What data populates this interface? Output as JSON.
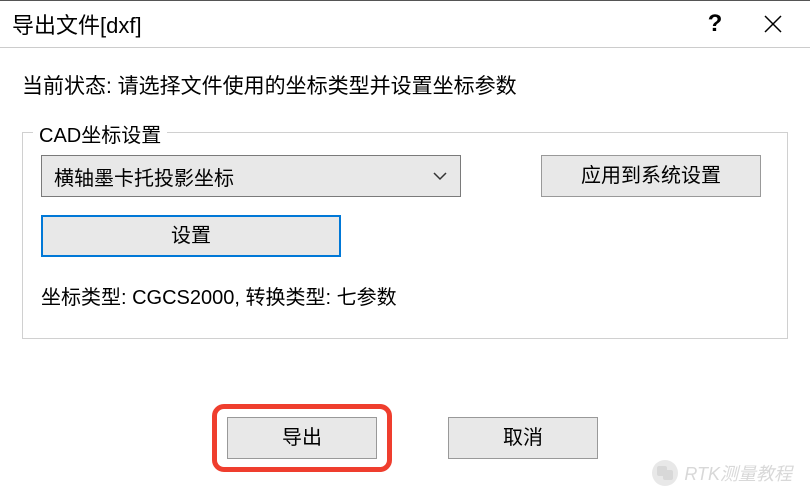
{
  "titlebar": {
    "title": "导出文件[dxf]",
    "help": "?",
    "close": "×"
  },
  "status": {
    "label": "当前状态: ",
    "text": "请选择文件使用的坐标类型并设置坐标参数"
  },
  "cad": {
    "legend": "CAD坐标设置",
    "projection": "横轴墨卡托投影坐标",
    "apply_btn": "应用到系统设置",
    "settings_btn": "设置",
    "info": "坐标类型: CGCS2000, 转换类型: 七参数"
  },
  "buttons": {
    "export": "导出",
    "cancel": "取消"
  },
  "watermark": {
    "text": "RTK测量教程"
  }
}
